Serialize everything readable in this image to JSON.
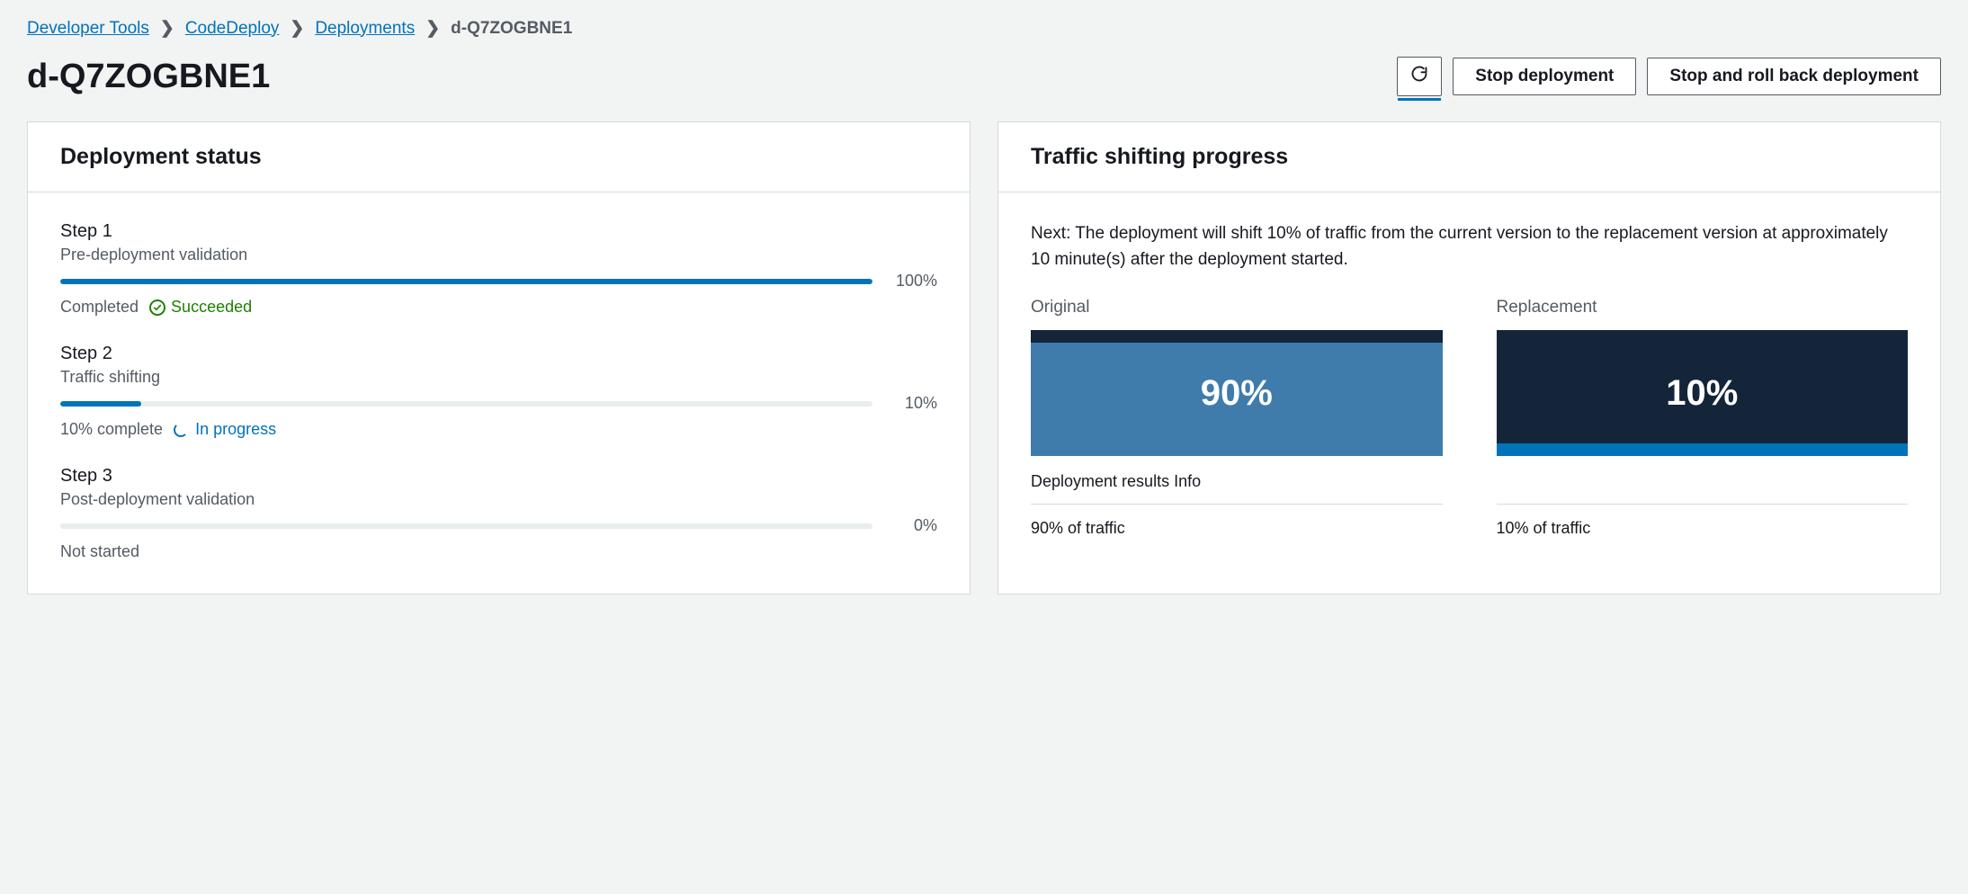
{
  "breadcrumb": {
    "items": [
      {
        "label": "Developer Tools"
      },
      {
        "label": "CodeDeploy"
      },
      {
        "label": "Deployments"
      }
    ],
    "current": "d-Q7ZOGBNE1"
  },
  "page_title": "d-Q7ZOGBNE1",
  "actions": {
    "stop_label": "Stop deployment",
    "stop_rollback_label": "Stop and roll back deployment"
  },
  "deployment_status": {
    "title": "Deployment status",
    "steps": [
      {
        "title": "Step 1",
        "sub": "Pre-deployment validation",
        "percent": 100,
        "percent_label": "100%",
        "status_prefix": "Completed",
        "status_kind": "success",
        "status_label": "Succeeded"
      },
      {
        "title": "Step 2",
        "sub": "Traffic shifting",
        "percent": 10,
        "percent_label": "10%",
        "status_prefix": "10% complete",
        "status_kind": "inprogress",
        "status_label": "In progress"
      },
      {
        "title": "Step 3",
        "sub": "Post-deployment validation",
        "percent": 0,
        "percent_label": "0%",
        "status_prefix": "Not started",
        "status_kind": "none",
        "status_label": ""
      }
    ]
  },
  "traffic": {
    "title": "Traffic shifting progress",
    "note": "Next: The deployment will shift 10% of traffic from the current version to the replacement version at approximately 10 minute(s) after the deployment started.",
    "original_label": "Original",
    "replacement_label": "Replacement",
    "original_pct": 90,
    "original_pct_label": "90%",
    "replacement_pct": 10,
    "replacement_pct_label": "10%",
    "results_label": "Deployment results Info",
    "original_traffic_text": "90% of traffic",
    "replacement_traffic_text": "10% of traffic"
  }
}
